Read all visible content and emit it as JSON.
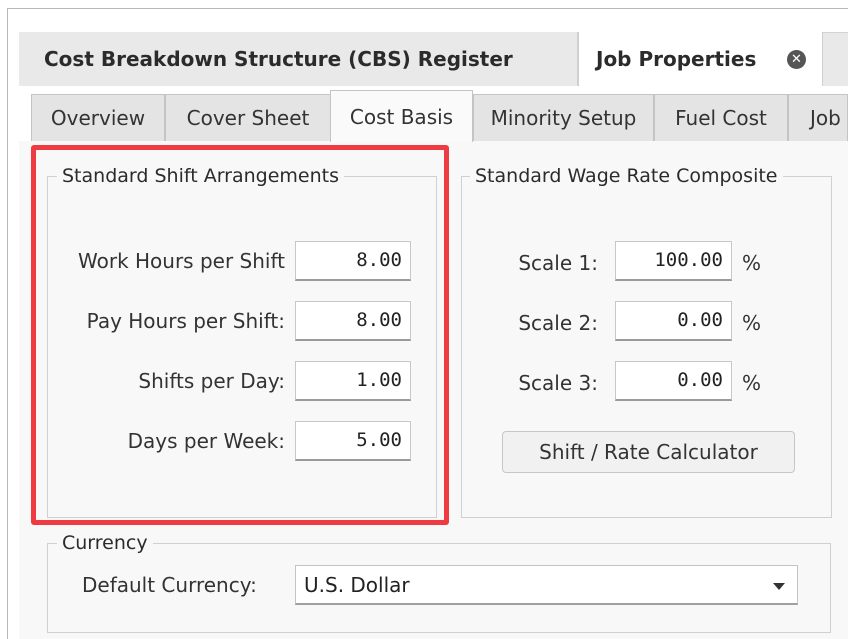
{
  "document_tabs": [
    {
      "label": "Cost Breakdown Structure (CBS) Register",
      "active": false
    },
    {
      "label": "Job Properties",
      "active": true
    }
  ],
  "job_tabs": [
    "Overview",
    "Cover Sheet",
    "Cost Basis",
    "Minority Setup",
    "Fuel Cost",
    "Job"
  ],
  "active_job_tab": "Cost Basis",
  "shift_group": {
    "title": "Standard Shift Arrangements",
    "fields": [
      {
        "label": "Work Hours per Shift",
        "value": "8.00"
      },
      {
        "label": "Pay Hours per Shift:",
        "value": "8.00"
      },
      {
        "label": "Shifts per Day:",
        "value": "1.00"
      },
      {
        "label": "Days per Week:",
        "value": "5.00"
      }
    ]
  },
  "wage_group": {
    "title": "Standard Wage Rate Composite",
    "fields": [
      {
        "label": "Scale 1:",
        "value": "100.00",
        "unit": "%"
      },
      {
        "label": "Scale 2:",
        "value": "0.00",
        "unit": "%"
      },
      {
        "label": "Scale 3:",
        "value": "0.00",
        "unit": "%"
      }
    ],
    "calculator_label": "Shift / Rate Calculator"
  },
  "currency_group": {
    "title": "Currency",
    "default_label": "Default Currency:",
    "selected": "U.S. Dollar"
  },
  "highlight_color": "#ee3b42",
  "icons": {
    "close": "close-circle-icon",
    "dropdown": "chevron-down-icon"
  }
}
